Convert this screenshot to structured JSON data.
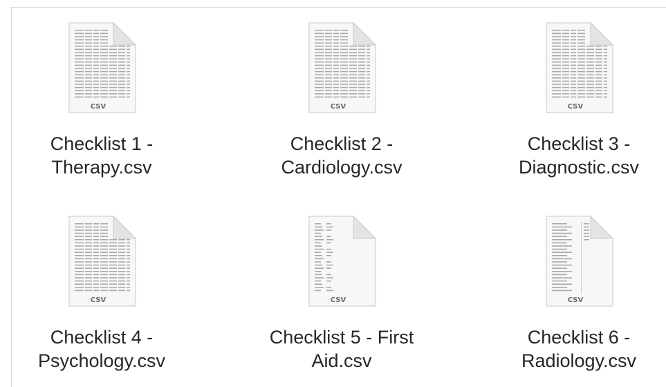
{
  "files": [
    {
      "name": "Checklist 1 -\nTherapy.csv",
      "ext": "CSV",
      "preview": "grid"
    },
    {
      "name": "Checklist 2 -\nCardiology.csv",
      "ext": "CSV",
      "preview": "grid"
    },
    {
      "name": "Checklist 3 -\nDiagnostic.csv",
      "ext": "CSV",
      "preview": "grid"
    },
    {
      "name": "Checklist 4 -\nPsychology.csv",
      "ext": "CSV",
      "preview": "grid"
    },
    {
      "name": "Checklist 5 - First\nAid.csv",
      "ext": "CSV",
      "preview": "two-column"
    },
    {
      "name": "Checklist 6 -\nRadiology.csv",
      "ext": "CSV",
      "preview": "list"
    }
  ]
}
